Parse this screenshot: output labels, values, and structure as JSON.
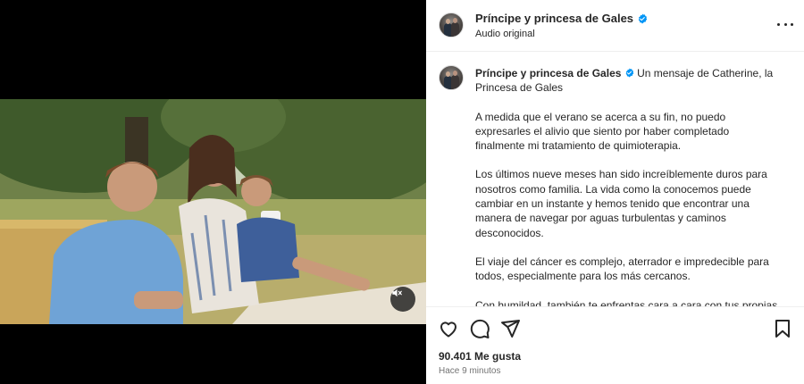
{
  "post": {
    "account_name": "Príncipe y princesa de Gales",
    "audio_label": "Audio original",
    "verified_color": "#0095f6"
  },
  "caption": {
    "author": "Príncipe y princesa de Gales",
    "intro": "Un mensaje de Catherine, la Princesa de Gales",
    "paragraphs": [
      "A medida que el verano se acerca a su fin, no puedo expresarles el alivio que siento por haber completado finalmente mi tratamiento de quimioterapia.",
      "Los últimos nueve meses han sido increíblemente duros para nosotros como familia. La vida como la conocemos puede cambiar en un instante y hemos tenido que encontrar una manera de navegar por aguas turbulentas y caminos desconocidos.",
      "El viaje del cáncer es complejo, aterrador e impredecible para todos, especialmente para los más cercanos.",
      "Con humildad, también te enfrentas cara a cara con tus propias vulnerabilidades de una manera que nunca antes habías"
    ]
  },
  "actions": {
    "like_icon": "heart-icon",
    "comment_icon": "comment-icon",
    "share_icon": "paper-plane-icon",
    "save_icon": "bookmark-icon"
  },
  "stats": {
    "likes": "90.401 Me gusta",
    "timestamp": "Hace 9 minutos"
  },
  "media": {
    "mute_icon": "speaker-muted-icon"
  }
}
